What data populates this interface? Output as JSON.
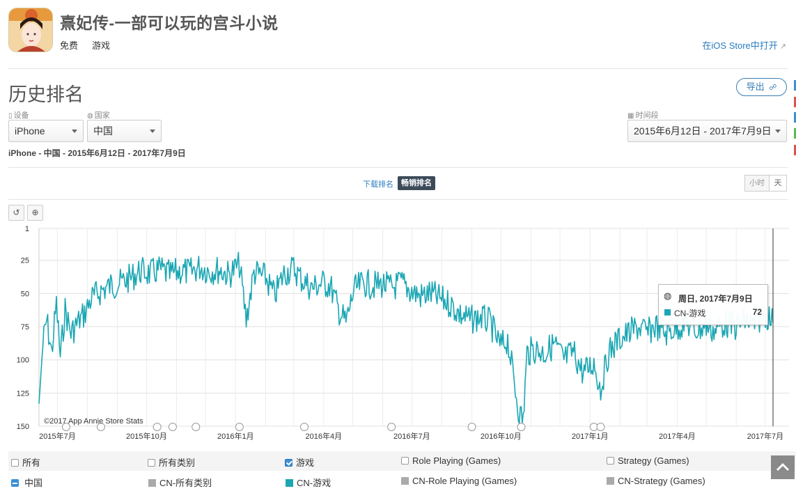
{
  "header": {
    "app_title": "熹妃传-一部可以玩的宫斗小说",
    "price_tag": "免费",
    "category_tag": "游戏",
    "open_store_link": "在iOS Store中打开"
  },
  "page": {
    "title": "历史排名",
    "export_label": "导出",
    "summary": "iPhone - 中国 - 2015年6月12日 - 2017年7月9日"
  },
  "filters": {
    "device_label": "设备",
    "device_value": "iPhone",
    "country_label": "国家",
    "country_value": "中国",
    "date_label": "时间段",
    "date_value": "2015年6月12日 - 2017年7月9日"
  },
  "rank_tabs": {
    "download": "下载排名",
    "grossing": "畅销排名"
  },
  "granularity": {
    "hour": "小时",
    "day": "天"
  },
  "chart_tools": {
    "reset_icon": "reset-icon",
    "zoom_icon": "zoom-icon"
  },
  "tooltip": {
    "date": "周日, 2017年7月9日",
    "series": "CN-游戏",
    "value": "72"
  },
  "chart_data": {
    "type": "line",
    "credit": "©2017 App Annie Store Stats",
    "y_reversed": true,
    "ylim": [
      1,
      150
    ],
    "y_ticks": [
      "1",
      "25",
      "50",
      "75",
      "100",
      "125",
      "150"
    ],
    "y_tick_values": [
      1,
      25,
      50,
      75,
      100,
      125,
      150
    ],
    "x_range": [
      "2015-06-12",
      "2017-07-09"
    ],
    "x_ticks": [
      "2015年7月",
      "2015年10月",
      "2016年1月",
      "2016年4月",
      "2016年7月",
      "2016年10月",
      "2017年1月",
      "2017年4月",
      "2017年7月"
    ],
    "x_tick_dates": [
      "2015-07-01",
      "2015-10-01",
      "2016-01-01",
      "2016-04-01",
      "2016-07-01",
      "2016-10-01",
      "2017-01-01",
      "2017-04-01",
      "2017-07-01"
    ],
    "grid": true,
    "series": [
      {
        "name": "CN-游戏",
        "color": "#1aa6b3",
        "points": [
          [
            "2015-06-12",
            133
          ],
          [
            "2015-06-16",
            88
          ],
          [
            "2015-06-20",
            70
          ],
          [
            "2015-06-25",
            95
          ],
          [
            "2015-06-30",
            58
          ],
          [
            "2015-07-04",
            98
          ],
          [
            "2015-07-09",
            62
          ],
          [
            "2015-07-15",
            80
          ],
          [
            "2015-07-22",
            72
          ],
          [
            "2015-07-29",
            65
          ],
          [
            "2015-08-05",
            54
          ],
          [
            "2015-08-15",
            48
          ],
          [
            "2015-08-25",
            44
          ],
          [
            "2015-09-05",
            42
          ],
          [
            "2015-09-15",
            38
          ],
          [
            "2015-09-25",
            33
          ],
          [
            "2015-10-05",
            35
          ],
          [
            "2015-10-15",
            32
          ],
          [
            "2015-10-25",
            36
          ],
          [
            "2015-11-05",
            33
          ],
          [
            "2015-11-15",
            34
          ],
          [
            "2015-11-25",
            30
          ],
          [
            "2015-12-05",
            33
          ],
          [
            "2015-12-15",
            32
          ],
          [
            "2015-12-25",
            36
          ],
          [
            "2016-01-05",
            28
          ],
          [
            "2016-01-12",
            70
          ],
          [
            "2016-01-20",
            34
          ],
          [
            "2016-02-01",
            38
          ],
          [
            "2016-02-10",
            52
          ],
          [
            "2016-02-20",
            35
          ],
          [
            "2016-03-01",
            31
          ],
          [
            "2016-03-10",
            40
          ],
          [
            "2016-03-20",
            46
          ],
          [
            "2016-03-30",
            42
          ],
          [
            "2016-04-08",
            44
          ],
          [
            "2016-04-16",
            62
          ],
          [
            "2016-04-24",
            72
          ],
          [
            "2016-05-02",
            48
          ],
          [
            "2016-05-12",
            42
          ],
          [
            "2016-05-22",
            44
          ],
          [
            "2016-06-01",
            43
          ],
          [
            "2016-06-10",
            46
          ],
          [
            "2016-06-20",
            42
          ],
          [
            "2016-06-30",
            48
          ],
          [
            "2016-07-10",
            52
          ],
          [
            "2016-07-20",
            50
          ],
          [
            "2016-07-30",
            54
          ],
          [
            "2016-08-10",
            58
          ],
          [
            "2016-08-20",
            66
          ],
          [
            "2016-08-30",
            70
          ],
          [
            "2016-09-10",
            68
          ],
          [
            "2016-09-20",
            72
          ],
          [
            "2016-09-30",
            90
          ],
          [
            "2016-10-08",
            85
          ],
          [
            "2016-10-15",
            118
          ],
          [
            "2016-10-20",
            140
          ],
          [
            "2016-10-24",
            145
          ],
          [
            "2016-10-28",
            95
          ],
          [
            "2016-11-05",
            92
          ],
          [
            "2016-11-15",
            95
          ],
          [
            "2016-11-25",
            88
          ],
          [
            "2016-12-05",
            100
          ],
          [
            "2016-12-15",
            94
          ],
          [
            "2016-12-25",
            110
          ],
          [
            "2017-01-05",
            102
          ],
          [
            "2017-01-12",
            122
          ],
          [
            "2017-01-20",
            95
          ],
          [
            "2017-01-30",
            85
          ],
          [
            "2017-02-10",
            80
          ],
          [
            "2017-02-20",
            75
          ],
          [
            "2017-03-01",
            80
          ],
          [
            "2017-03-10",
            74
          ],
          [
            "2017-03-20",
            80
          ],
          [
            "2017-03-30",
            76
          ],
          [
            "2017-04-10",
            72
          ],
          [
            "2017-04-20",
            78
          ],
          [
            "2017-05-01",
            74
          ],
          [
            "2017-05-10",
            78
          ],
          [
            "2017-05-20",
            72
          ],
          [
            "2017-06-01",
            75
          ],
          [
            "2017-06-10",
            70
          ],
          [
            "2017-06-20",
            74
          ],
          [
            "2017-06-30",
            64
          ],
          [
            "2017-07-09",
            72
          ]
        ]
      }
    ]
  },
  "legend": {
    "row1": {
      "all": "所有",
      "all_categories": "所有类别",
      "games": "游戏",
      "role_playing": "Role Playing (Games)",
      "strategy": "Strategy (Games)"
    },
    "row2": {
      "country": "中国",
      "cn_all": "CN-所有类别",
      "cn_games": "CN-游戏",
      "cn_role_playing": "CN-Role Playing (Games)",
      "cn_strategy": "CN-Strategy (Games)"
    }
  },
  "colors": {
    "series": "#1aa6b3",
    "inactive_series": "#aaaaaa",
    "accent": "#2a7cbf",
    "active_tab": "#3c4a5a",
    "side_marks": [
      "#3a8fd8",
      "#d9534f",
      "#3a8fd8",
      "#5cb85c",
      "#d9534f"
    ]
  }
}
